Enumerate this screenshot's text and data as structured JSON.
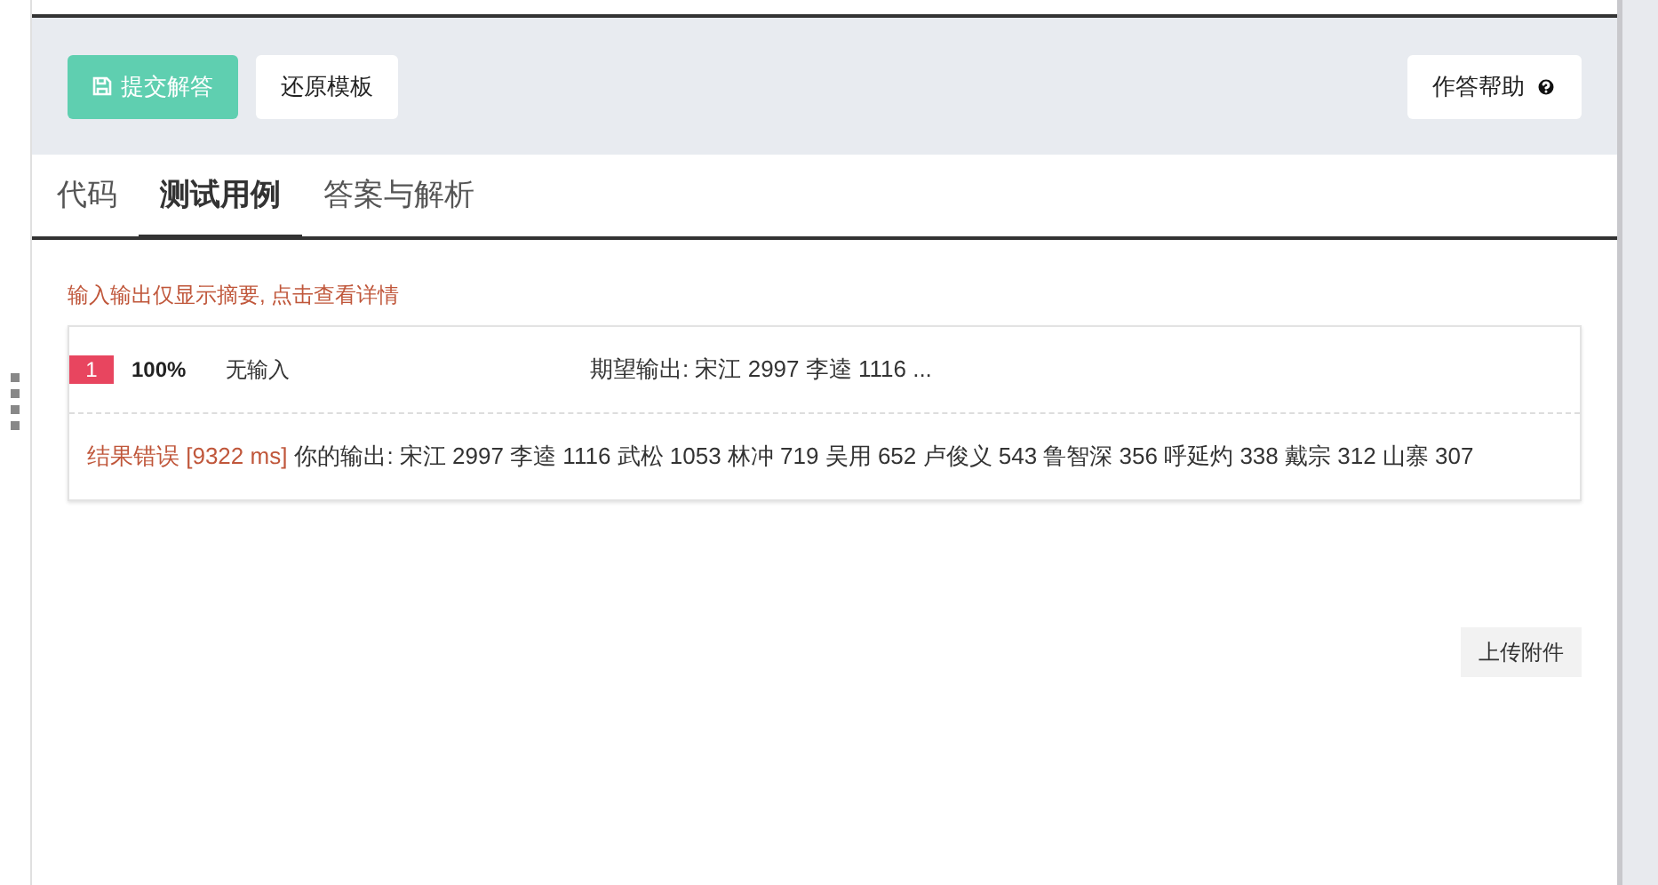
{
  "toolbar": {
    "buttons": [
      {
        "label": "提交解答",
        "kind": "primary"
      },
      {
        "label": "还原模板",
        "kind": "plain"
      }
    ],
    "help_button": {
      "label": "作答帮助"
    }
  },
  "tabs": [
    {
      "label": "代码",
      "selected": false
    },
    {
      "label": "测试用例",
      "selected": true
    },
    {
      "label": "答案与解析",
      "selected": false
    }
  ],
  "hint": "输入输出仅显示摘要, 点击查看详情",
  "test_cases": [
    {
      "number": "1",
      "score": "100%",
      "input": "无输入",
      "expected": "期望输出: 宋江 2997 李逵 1116 ...",
      "status": "结果错误 [9322 ms]",
      "output": "你的输出: 宋江 2997 李逵 1116 武松 1053 林冲 719 吴用 652 卢俊义 543 鲁智深 356 呼延灼 338 戴宗 312 山寨 307"
    }
  ],
  "upload_button": "上传附件"
}
